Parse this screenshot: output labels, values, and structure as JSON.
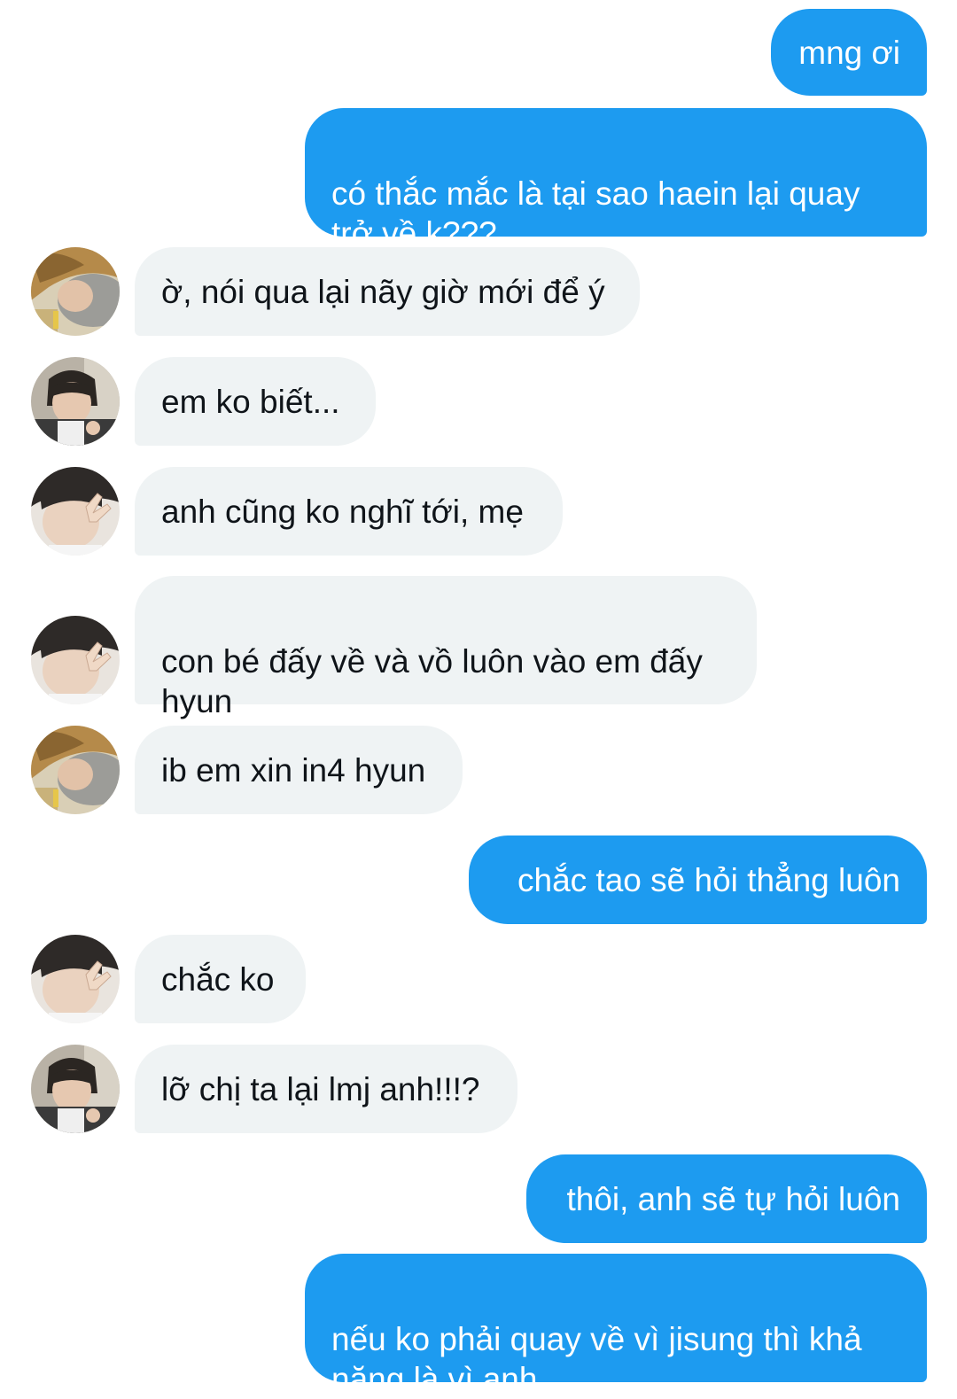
{
  "conversation": {
    "messages": [
      {
        "sender": "me",
        "text": "mng ơi"
      },
      {
        "sender": "me",
        "text": "có thắc mắc là tại sao haein lại quay\ntrở về k???..."
      },
      {
        "sender": "blonde-avatar",
        "text": "ờ, nói qua lại nãy giờ mới để ý"
      },
      {
        "sender": "glasses-avatar",
        "text": "em ko biết..."
      },
      {
        "sender": "peace-avatar",
        "text": "anh cũng ko nghĩ tới, mẹ"
      },
      {
        "sender": "peace-avatar",
        "text": "con bé đấy về và vồ luôn vào em đấy\nhyun"
      },
      {
        "sender": "blonde-avatar",
        "text": "ib em xin in4 hyun"
      },
      {
        "sender": "me",
        "text": "chắc tao sẽ hỏi thẳng luôn"
      },
      {
        "sender": "peace-avatar",
        "text": "chắc ko"
      },
      {
        "sender": "glasses-avatar",
        "text": "lỡ chị ta lại lmj anh!!!?"
      },
      {
        "sender": "me",
        "text": "thôi, anh sẽ tự hỏi luôn"
      },
      {
        "sender": "me",
        "text": "nếu ko phải quay về vì jisung thì khả\nnăng là vì anh"
      }
    ]
  },
  "colors": {
    "sent_bubble": "#1d9bf0",
    "received_bubble": "#eff3f4",
    "sent_text": "#ffffff",
    "received_text": "#0f1419"
  }
}
